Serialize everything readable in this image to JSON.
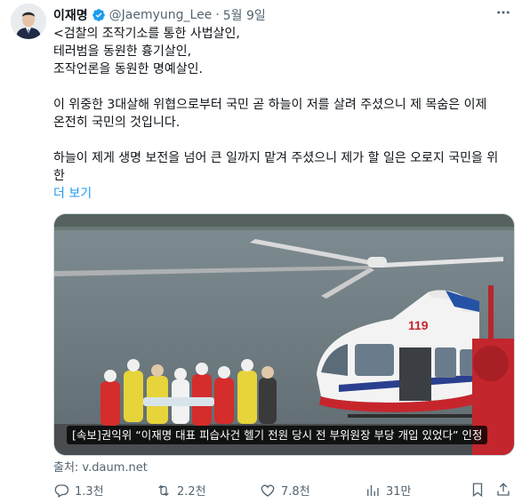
{
  "author": {
    "name": "이재명",
    "handle": "@Jaemyung_Lee",
    "separator": "·",
    "timestamp": "5월 9일"
  },
  "tweet": {
    "lines": [
      "<검찰의 조작기소를 통한 사법살인,",
      "테러범을 동원한 흉기살인,",
      "조작언론을 동원한 명예살인.",
      "",
      "이 위중한 3대살해 위협으로부터 국민 곧 하늘이 저를 살려 주셨으니 제 목숨은 이제",
      "온전히 국민의 것입니다.",
      "",
      "하늘이 제게 생명 보전을 넘어 큰 일까지 맡겨 주셨으니 제가 할 일은 오로지 국민을 위",
      "한"
    ],
    "show_more": "더 보기"
  },
  "media": {
    "headline": "[속보]권익위 “이재명 대표 피습사건 헬기 전원 당시 전 부위원장 부당 개입 있었다” 인정",
    "helicopter_number": "119"
  },
  "source": "출처: v.daum.net",
  "actions": {
    "reply_count": "1.3천",
    "retweet_count": "2.2천",
    "like_count": "7.8천",
    "view_count": "31만"
  },
  "colors": {
    "text": "#0f1419",
    "muted": "#536471",
    "link": "#1d9bf0",
    "verified": "#1d9bf0"
  }
}
